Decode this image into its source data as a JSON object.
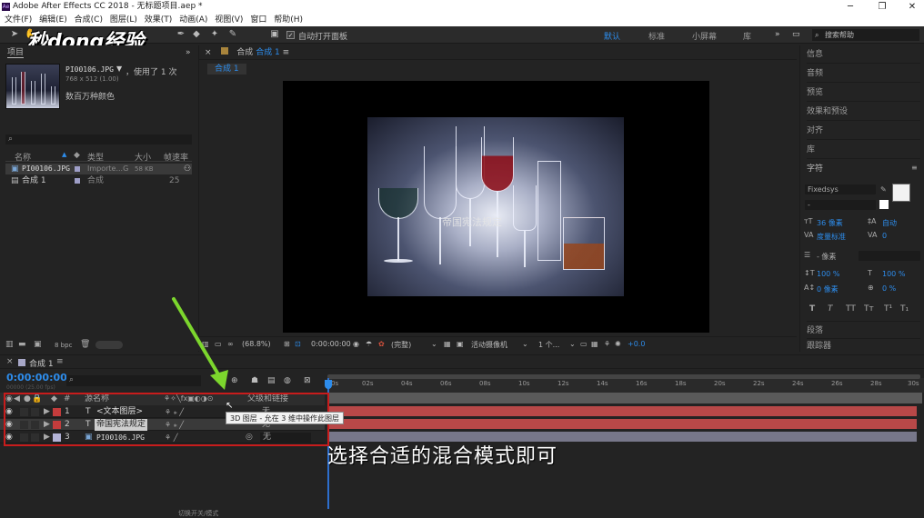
{
  "titlebar": {
    "title": "Adobe After Effects CC 2018 - 无标题项目.aep *"
  },
  "menu": [
    "文件(F)",
    "编辑(E)",
    "合成(C)",
    "图层(L)",
    "效果(T)",
    "动画(A)",
    "视图(V)",
    "窗口",
    "帮助(H)"
  ],
  "watermark": "秒dong经验",
  "toolbar": {
    "auto_open_label": "自动打开面板",
    "workspaces": [
      "默认",
      "标准",
      "小屏幕",
      "库"
    ],
    "active_workspace": "默认",
    "search_placeholder": "搜索帮助"
  },
  "project": {
    "tab": "项目",
    "file_name": "PI00106.JPG",
    "used": "，使用了 1 次",
    "dims": "768 x 512 (1.00)",
    "colors": "数百万种颜色",
    "columns": {
      "name": "名称",
      "type": "类型",
      "size": "大小",
      "fps": "帧速率"
    },
    "items": [
      {
        "name": "PI00106.JPG",
        "type": "Importe...G",
        "size": "58 KB",
        "fps": ""
      },
      {
        "name": "合成 1",
        "type": "合成",
        "size": "",
        "fps": "25"
      }
    ],
    "bpc": "8 bpc"
  },
  "viewer": {
    "panel_label": "合成",
    "comp_name": "合成 1",
    "tab": "合成 1",
    "overlay_text": "帝国宪法规定",
    "zoom": "(68.8%)",
    "time": "0:00:00:00",
    "quality": "(完整)",
    "camera": "活动摄像机",
    "views": "1 个...",
    "exposure": "+0.0"
  },
  "right_panel": {
    "items": [
      "信息",
      "音频",
      "预览",
      "效果和预设",
      "对齐",
      "库"
    ],
    "character": {
      "title": "字符",
      "font": "Fixedsys",
      "style": "-",
      "size": "36 像素",
      "leading": "自动",
      "kerning": "度量标准",
      "tracking": "0",
      "stroke": "- 像素",
      "vscale": "100 %",
      "hscale": "100 %",
      "baseline": "0 像素",
      "tsume": "0 %",
      "styles": [
        "T",
        "T",
        "TT",
        "Tт",
        "T¹",
        "T₁"
      ]
    },
    "paragraph": "段落",
    "tracker": "跟踪器"
  },
  "timeline": {
    "comp_tab": "合成 1",
    "timecode": "0:00:00:00",
    "fps": "00000 (25.00 fps)",
    "col_source": "源名称",
    "col_parent": "父级和链接",
    "layers": [
      {
        "num": "1",
        "type": "T",
        "name": "<文本图层>",
        "color": "#c43c3c",
        "parent": "无"
      },
      {
        "num": "2",
        "type": "T",
        "name": "帝国宪法规定",
        "color": "#c43c3c",
        "parent": "无"
      },
      {
        "num": "3",
        "type": "img",
        "name": "PI00106.JPG",
        "color": "#b2b2d6",
        "parent": "无"
      }
    ],
    "ruler": [
      "0s",
      "02s",
      "04s",
      "06s",
      "08s",
      "10s",
      "12s",
      "14s",
      "16s",
      "18s",
      "20s",
      "22s",
      "24s",
      "26s",
      "28s",
      "30s"
    ],
    "tooltip": "3D 图层 - 允在 3 维中操作此图层",
    "bottom_label": "切换开关/模式"
  },
  "caption": "选择合适的混合模式即可",
  "colors": {
    "accent": "#2d8ceb",
    "bar_red": "#b84848",
    "bar_purple": "#77778a",
    "highlight": "#c81c1c",
    "arrow": "#7cd62d"
  }
}
